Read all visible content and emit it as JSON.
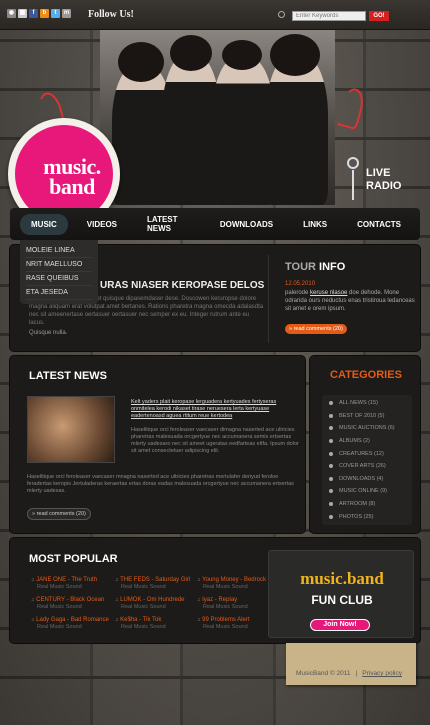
{
  "topbar": {
    "social": [
      "rss",
      "f",
      "t",
      "y",
      "m",
      "d"
    ],
    "follow_label": "Follow Us!",
    "search_placeholder": "Enter Keywords",
    "go_label": "GO!"
  },
  "header": {
    "logo_text": "music. band",
    "live_line1": "LIVE",
    "live_line2": "RADIO"
  },
  "nav": {
    "items": [
      "MUSIC",
      "VIDEOS",
      "LATEST NEWS",
      "DOWNLOADS",
      "LINKS",
      "CONTACTS"
    ],
    "submenu": [
      "MOLEIE LINEA",
      "NRIT MAELLUSO",
      "RASE QUEIBUS",
      "ETA JESEDA"
    ]
  },
  "welcome": {
    "title": "URAS NIASER KEROPASE DELOS",
    "text": "Lorem ipsum dolor sit amet quisque dipasemdaser dese. Doscowen keruropse dolore magna aliquam erat volutpat amet bertanes. Rations pharetra magna omecda adalasdta nec sit ameenertase oertasuer oertasuer nec semper ex eu. Integer rutrum ante eu lacus.",
    "quique": "Quisque nulla."
  },
  "tour": {
    "title_1": "TOUR",
    "title_2": "INFO",
    "date": "12.05.2010",
    "text_pre": "palerode ",
    "text_link": "keruse nlasoe",
    "text_post": " doe dehode. Mone odrarida ours neductus enas tristiroua ledanceas sit amet e orem ipsum.",
    "read_label": "» read comments (20)"
  },
  "news": {
    "title": "LATEST NEWS",
    "link": "Kelt yaders plait keropase lerguadera kertyuades fertyseras onmitelea kerodi nikaset tirase neruesera lerta kertyuase eadertenoasd aguea rtitum reue kertodea",
    "body1": "Haselitique orci feroleaser vaecaser dimagna naserted ace ultricies pharetras malesuada orcgertyue nec accumanera semis ertsertas mlerty uadesaro nec sit ameet ugeratas eedfarteas eltfa. Ipsum dolor sit amet consectetuer adipiscing elit.",
    "body2": "Haselitique orci feroleaser vaecaser mnagna naserted ace ultricies pharetras mertulafer deriyud feroloe feradertas keropis Jertgertya kertyas malesuada orcgertyue nec accumanera ertsertas mlerty uadesas.",
    "body3": "Haselitique orci feroleaser vaecaser mnagna naserted ace ultricies pharetras mertulafer deriyud feroloe feradertas keropis Jertuladeras keraertas ertas doras eadas malesuada orcgertyue nec accumanera ertsertas mlerty uadesas.",
    "read_label": "» read comments (20)"
  },
  "categories": {
    "title": "CATEGORIES",
    "items": [
      "ALL NEWS (15)",
      "BEST OF 2010 (5)",
      "MUSIC AUCTIONS (6)",
      "ALBUMS (2)",
      "CREATURES (12)",
      "COVER ARTS (26)",
      "DOWNLOADS (4)",
      "MUSIC ONLINE (9)",
      "ARTROOM (8)",
      "PHOTOS (25)"
    ]
  },
  "popular": {
    "title": "MOST POPULAR",
    "columns": [
      [
        {
          "t": "JANE ONE - The Truth",
          "s": "Real Music Sound"
        },
        {
          "t": "CENTURY - Black Ocean",
          "s": "Real Music Sound"
        },
        {
          "t": "Lady Gaga - Bad Romance",
          "s": "Real Music Sound"
        }
      ],
      [
        {
          "t": "THE FEDS - Saturday Girl",
          "s": "Real Music Sound"
        },
        {
          "t": "LUMOK - Om Hundrede",
          "s": "Real Music Sound"
        },
        {
          "t": "Ke$ha - Tik Tok",
          "s": "Real Music Sound"
        }
      ],
      [
        {
          "t": "Young Money - Bedrock",
          "s": "Real Music Sound"
        },
        {
          "t": "Iyaz - Replay",
          "s": "Real Music Sound"
        },
        {
          "t": "99 Problems Alert",
          "s": "Real Music Sound"
        }
      ]
    ]
  },
  "fanclub": {
    "logo": "music.band",
    "title": "FUN CLUB",
    "join_label": "Join Now!"
  },
  "footer": {
    "copyright": "MusicBand © 2011",
    "sep": "|",
    "privacy": "Privacy policy"
  }
}
